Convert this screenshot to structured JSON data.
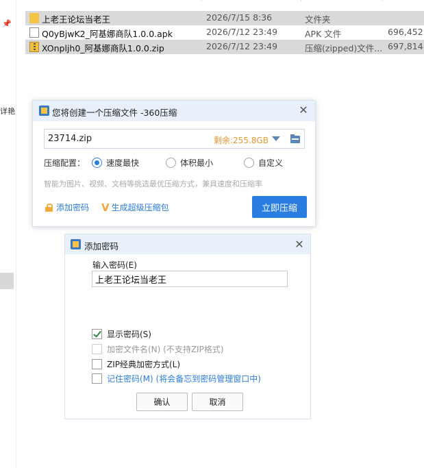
{
  "explorer": {
    "sidebar_text": "详艳",
    "files": [
      {
        "name": "上老王论坛当老王",
        "date": "2026/7/15 8:36",
        "type": "文件夹",
        "size": "",
        "icon": "folder-icon"
      },
      {
        "name": "Q0yBjwK2_阿基娜商队1.0.0.apk",
        "date": "2026/7/12 23:49",
        "type": "APK 文件",
        "size": "696,452",
        "icon": "apk-file-icon"
      },
      {
        "name": "XOnpljh0_阿基娜商队1.0.0.zip",
        "date": "2026/7/12 23:49",
        "type": "压缩(zipped)文件...",
        "size": "697,814",
        "icon": "zip-file-icon"
      }
    ]
  },
  "compress_dialog": {
    "title": "您将创建一个压缩文件 -360压缩",
    "path_value": "23714.zip",
    "free_space": "剩余:255.8GB",
    "config_label": "压缩配置：",
    "options": [
      {
        "label": "速度最快",
        "selected": true
      },
      {
        "label": "体积最小",
        "selected": false
      },
      {
        "label": "自定义",
        "selected": false
      }
    ],
    "hint": "智能为图片、视频、文档等挑选最优压缩方式，兼具速度和压缩率",
    "add_password_link": "添加密码",
    "sfx_link": "生成超级压缩包",
    "compress_button": "立即压缩",
    "accent_color": "#2a7de1"
  },
  "password_dialog": {
    "title": "添加密码",
    "input_label": "输入密码(E)",
    "password_value": "上老王论坛当老王",
    "checkboxes": [
      {
        "label": "显示密码(S)",
        "checked": true
      },
      {
        "label": "加密文件名(N) (不支持ZIP格式)",
        "checked": false
      },
      {
        "label": "ZIP经典加密方式(L)",
        "checked": false
      },
      {
        "label": "记住密码(M) (将会备忘到密码管理窗口中)",
        "checked": false
      }
    ],
    "ok_button": "确认",
    "cancel_button": "取消"
  }
}
